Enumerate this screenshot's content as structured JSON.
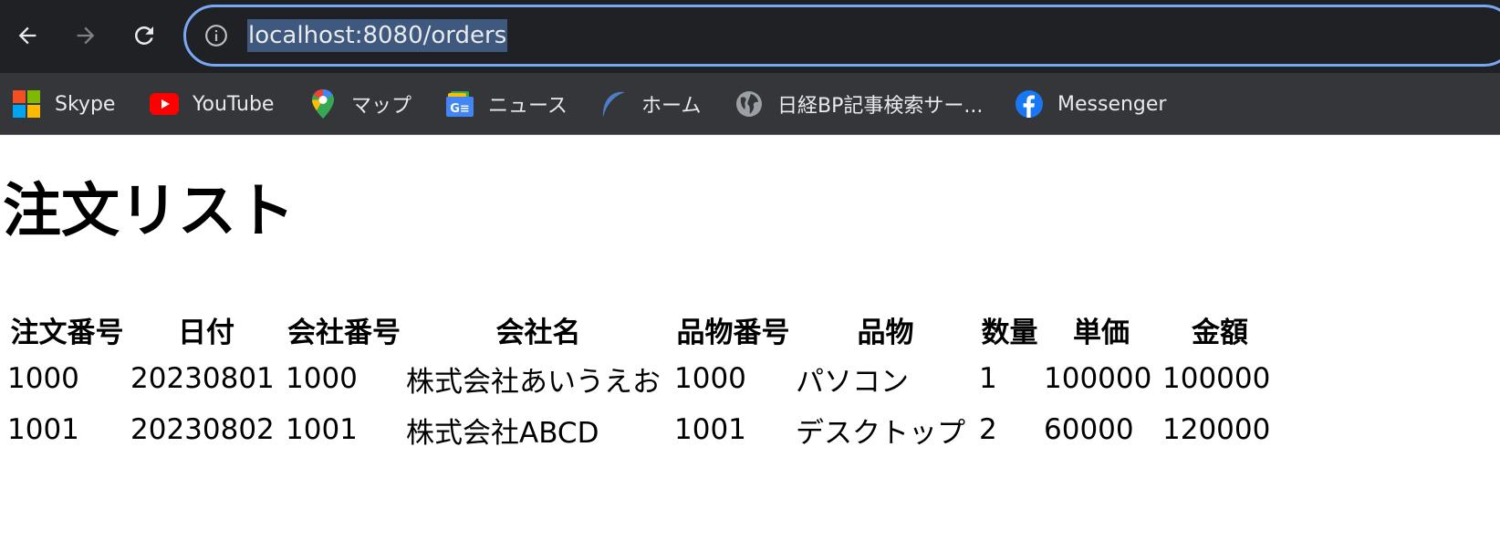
{
  "browser": {
    "url": "localhost:8080/orders",
    "bookmarks": [
      {
        "label": "Skype",
        "icon": "microsoft-logo-icon"
      },
      {
        "label": "YouTube",
        "icon": "youtube-icon"
      },
      {
        "label": "マップ",
        "icon": "google-maps-icon"
      },
      {
        "label": "ニュース",
        "icon": "google-news-icon"
      },
      {
        "label": "ホーム",
        "icon": "crescent-icon"
      },
      {
        "label": "日経BP記事検索サー...",
        "icon": "globe-icon"
      },
      {
        "label": "Messenger",
        "icon": "facebook-icon"
      }
    ],
    "colors": {
      "toolbar": "#202124",
      "bookmark_bar": "#35363a",
      "omnibox_border": "#7aa7f5",
      "url_selection": "#3f587e"
    }
  },
  "page": {
    "title": "注文リスト",
    "table": {
      "headers": [
        "注文番号",
        "日付",
        "会社番号",
        "会社名",
        "品物番号",
        "品物",
        "数量",
        "単価",
        "金額"
      ],
      "rows": [
        [
          "1000",
          "20230801",
          "1000",
          "株式会社あいうえお",
          "1000",
          "パソコン",
          "1",
          "100000",
          "100000"
        ],
        [
          "1001",
          "20230802",
          "1001",
          "株式会社ABCD",
          "1001",
          "デスクトップ",
          "2",
          "60000",
          "120000"
        ]
      ]
    }
  }
}
